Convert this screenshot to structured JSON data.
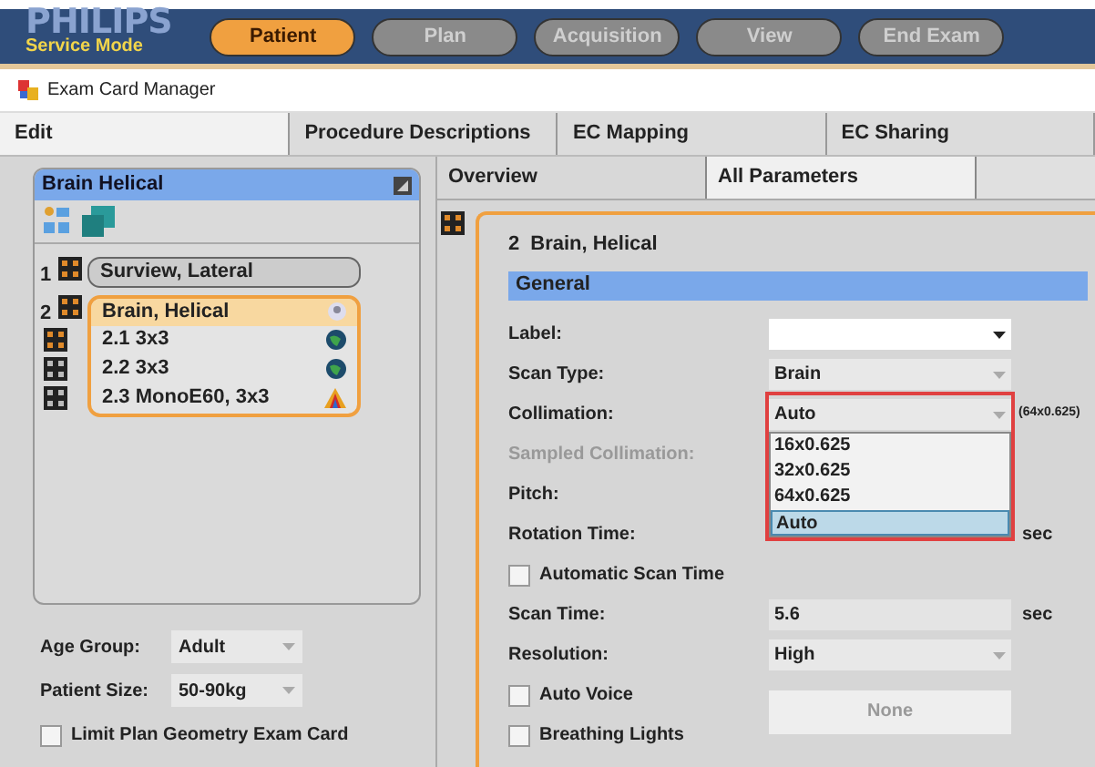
{
  "top_bar": {
    "brand": "PHILIPS",
    "mode": "Service Mode",
    "workflow_tabs": [
      {
        "label": "Patient",
        "selected": true
      },
      {
        "label": "Plan",
        "selected": false
      },
      {
        "label": "Acquisition",
        "selected": false
      },
      {
        "label": "View",
        "selected": false
      },
      {
        "label": "End Exam",
        "selected": false
      }
    ]
  },
  "window": {
    "title": "Exam Card Manager"
  },
  "tabs": [
    {
      "label": "Edit",
      "selected": true
    },
    {
      "label": "Procedure Descriptions",
      "selected": false
    },
    {
      "label": "EC Mapping",
      "selected": false
    },
    {
      "label": "EC Sharing",
      "selected": false
    }
  ],
  "exam_card": {
    "title": "Brain Helical",
    "scans": [
      {
        "number": "1",
        "label": "Surview, Lateral",
        "selected": false
      },
      {
        "number": "2",
        "label": "Brain, Helical",
        "selected": true,
        "children": [
          {
            "label": "2.1 3x3",
            "active": true,
            "kind": "globe"
          },
          {
            "label": "2.2 3x3",
            "active": false,
            "kind": "globe"
          },
          {
            "label": "2.3 MonoE60, 3x3",
            "active": false,
            "kind": "spectrum"
          }
        ]
      }
    ]
  },
  "age_group": {
    "label": "Age Group:",
    "value": "Adult"
  },
  "patient_size": {
    "label": "Patient Size:",
    "value": "50-90kg"
  },
  "limit_plan": {
    "label": "Limit Plan Geometry Exam Card",
    "checked": false
  },
  "sub_tabs": [
    {
      "label": "Overview",
      "selected": false
    },
    {
      "label": "All Parameters",
      "selected": true
    }
  ],
  "section": {
    "number": "2",
    "title": "Brain, Helical",
    "group": "General"
  },
  "params": [
    {
      "kind": "dropdown",
      "label": "Label:",
      "disabled": false
    },
    {
      "kind": "dropdown",
      "label": "Scan Type:",
      "value": "Brain",
      "disabled": true
    },
    {
      "kind": "dropdown",
      "label": "Collimation:",
      "value": "Auto",
      "note": "(64x0.625)",
      "disabled": true,
      "open": true,
      "options": [
        {
          "label": "16x0.625",
          "selected": false
        },
        {
          "label": "32x0.625",
          "selected": false
        },
        {
          "label": "64x0.625",
          "selected": false
        },
        {
          "label": "Auto",
          "selected": true
        }
      ]
    },
    {
      "kind": "label",
      "label": "Sampled Collimation:",
      "disabled": true
    },
    {
      "kind": "label",
      "label": "Pitch:",
      "disabled": false
    },
    {
      "kind": "label",
      "label": "Rotation Time:",
      "unit": "sec",
      "disabled": false
    },
    {
      "kind": "checkbox",
      "label": "Automatic Scan Time",
      "checked": false
    },
    {
      "kind": "text",
      "label": "Scan Time:",
      "value": "5.6",
      "unit": "sec"
    },
    {
      "kind": "dropdown",
      "label": "Resolution:",
      "value": "High",
      "disabled": true
    },
    {
      "kind": "checkbox",
      "label": "Auto Voice",
      "checked": false,
      "button": "None"
    },
    {
      "kind": "checkbox",
      "label": "Breathing Lights",
      "checked": false
    }
  ]
}
